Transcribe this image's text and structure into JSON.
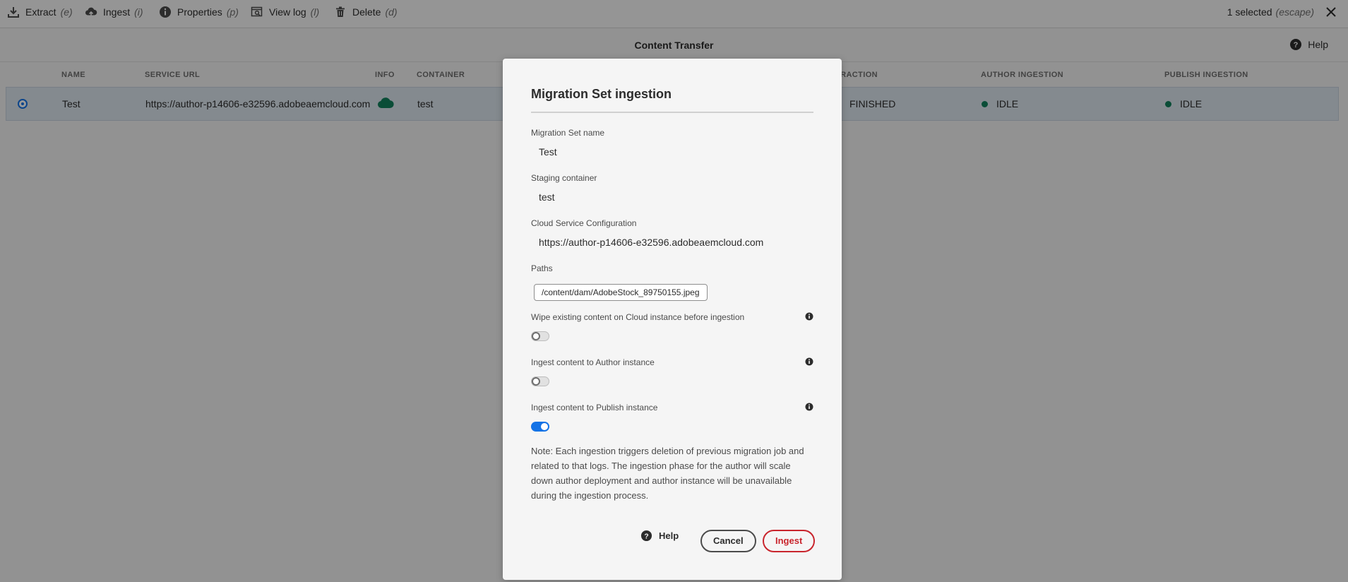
{
  "toolbar": {
    "actions": [
      {
        "label": "Extract",
        "key": "(e)",
        "icon": "download-icon"
      },
      {
        "label": "Ingest",
        "key": "(i)",
        "icon": "cloud-upload-icon"
      },
      {
        "label": "Properties",
        "key": "(p)",
        "icon": "info-icon"
      },
      {
        "label": "View log",
        "key": "(l)",
        "icon": "view-log-icon"
      },
      {
        "label": "Delete",
        "key": "(d)",
        "icon": "trash-icon"
      }
    ],
    "selection_label": "1 selected",
    "selection_key": "(escape)"
  },
  "header": {
    "title": "Content Transfer",
    "help_label": "Help"
  },
  "table": {
    "columns": [
      "NAME",
      "SERVICE URL",
      "INFO",
      "CONTAINER",
      "TRACTION",
      "AUTHOR INGESTION",
      "PUBLISH INGESTION"
    ],
    "rows": [
      {
        "name": "Test",
        "service_url": "https://author-p14606-e32596.adobeaemcloud.com",
        "info_icon": "cloud-icon",
        "container": "test",
        "extraction": "FINISHED",
        "author_ingestion": "IDLE",
        "publish_ingestion": "IDLE"
      }
    ],
    "status_color": "#12805c",
    "info_icon_color": "#12805c"
  },
  "dialog": {
    "title": "Migration Set ingestion",
    "fields": {
      "migration_set_name_label": "Migration Set name",
      "migration_set_name_value": "Test",
      "staging_container_label": "Staging container",
      "staging_container_value": "test",
      "cloud_service_label": "Cloud Service Configuration",
      "cloud_service_value": "https://author-p14606-e32596.adobeaemcloud.com",
      "paths_label": "Paths",
      "paths": [
        "/content/dam/AdobeStock_89750155.jpeg"
      ]
    },
    "toggles": [
      {
        "label": "Wipe existing content on Cloud instance before ingestion",
        "on": false
      },
      {
        "label": "Ingest content to Author instance",
        "on": false
      },
      {
        "label": "Ingest content to Publish instance",
        "on": true
      }
    ],
    "note": "Note: Each ingestion triggers deletion of previous migration job and related to that logs. The ingestion phase for the author will scale down author deployment and author instance will be unavailable during the ingestion process.",
    "help_label": "Help",
    "cancel_label": "Cancel",
    "ingest_label": "Ingest"
  },
  "colors": {
    "accent": "#1473e6",
    "cta_red": "#c9252d"
  }
}
